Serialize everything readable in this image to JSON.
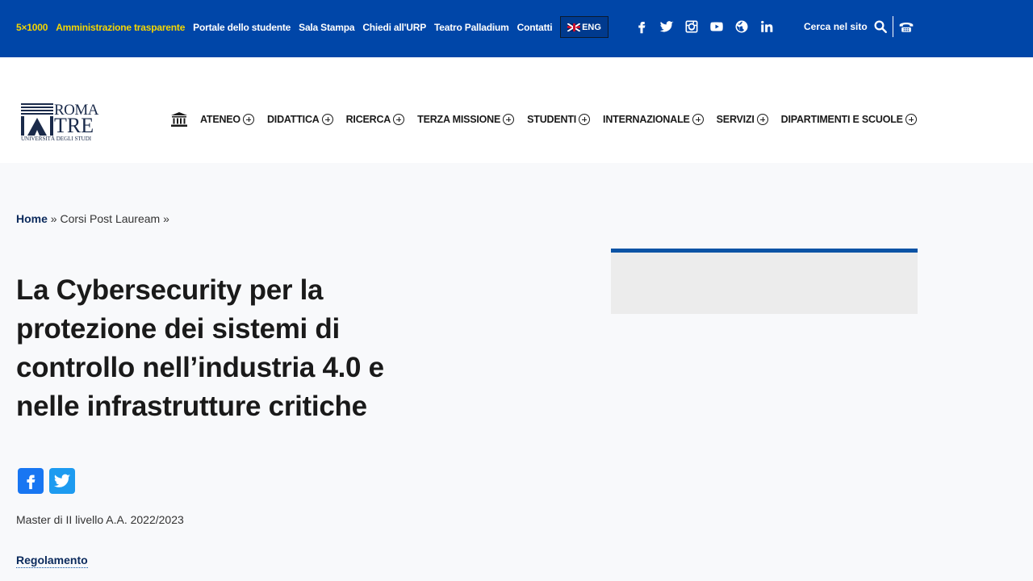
{
  "topbar": {
    "links": [
      {
        "label": "5×1000",
        "highlight": true
      },
      {
        "label": "Amministrazione trasparente",
        "highlight": true
      },
      {
        "label": "Portale dello studente",
        "highlight": false
      },
      {
        "label": "Sala Stampa",
        "highlight": false
      },
      {
        "label": "Chiedi all'URP",
        "highlight": false
      },
      {
        "label": "Teatro Palladium",
        "highlight": false
      },
      {
        "label": "Contatti",
        "highlight": false
      }
    ],
    "eng_label": "ENG",
    "social_icons": [
      "facebook-icon",
      "twitter-icon",
      "instagram-icon",
      "youtube-icon",
      "globe-icon",
      "linkedin-icon"
    ],
    "search_label": "Cerca nel sito",
    "colors": {
      "background": "#0046a8",
      "highlight": "#f5d600"
    }
  },
  "logo": {
    "line1": "ROMA",
    "line2": "TRE",
    "subtitle": "UNIVERSITÀ DEGLI STUDI"
  },
  "nav": {
    "items": [
      "ATENEO",
      "DIDATTICA",
      "RICERCA",
      "TERZA MISSIONE",
      "STUDENTI",
      "INTERNAZIONALE",
      "SERVIZI",
      "DIPARTIMENTI E SCUOLE"
    ]
  },
  "breadcrumb": {
    "home": "Home",
    "sep1": " » ",
    "current": "Corsi Post Lauream",
    "sep2": " »"
  },
  "page": {
    "title": "La Cybersecurity per la protezione dei sistemi di controllo nell’industria 4.0 e nelle infrastrutture critiche",
    "subtitle": "Master di II livello A.A. 2022/2023",
    "link": "Regolamento"
  },
  "accent_color": "#0b53a5"
}
